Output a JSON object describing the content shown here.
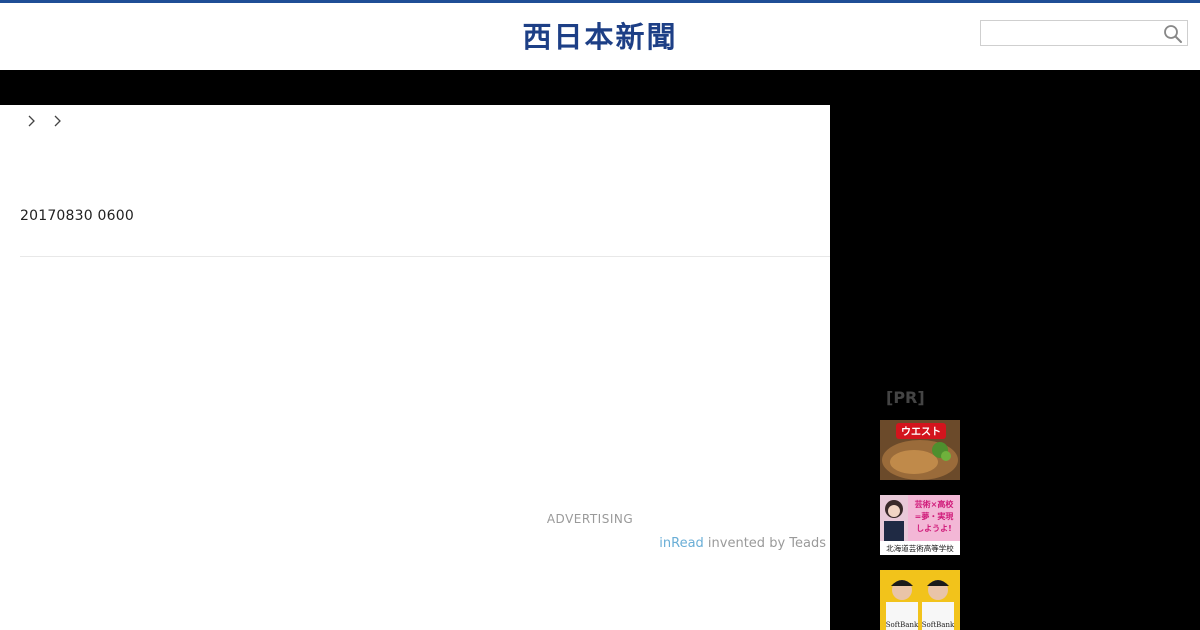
{
  "header": {
    "logo_text": "西日本新聞",
    "search": {
      "placeholder": ""
    }
  },
  "colors": {
    "brand_blue": "#1d3f86",
    "topbar_blue": "#1f4e96",
    "nav_black": "#000000",
    "inread_blue": "#6aaed6"
  },
  "breadcrumb": {
    "separators": [
      "chevron-right-icon",
      "chevron-right-icon"
    ]
  },
  "article": {
    "date": "20170830 0600"
  },
  "advertising": {
    "label": "ADVERTISING",
    "inread_brand": "inRead",
    "inread_suffix": " invented by Teads"
  },
  "sidebar": {
    "pr_label": "[PR]",
    "thumbs": [
      {
        "badge": "ウエスト"
      },
      {
        "line1": "芸術×高校",
        "line2": "=夢・実現",
        "line3": "しようよ!",
        "caption": "北海道芸術高等学校"
      },
      {
        "logo_left": "SoftBank",
        "logo_right": "SoftBank"
      }
    ]
  }
}
